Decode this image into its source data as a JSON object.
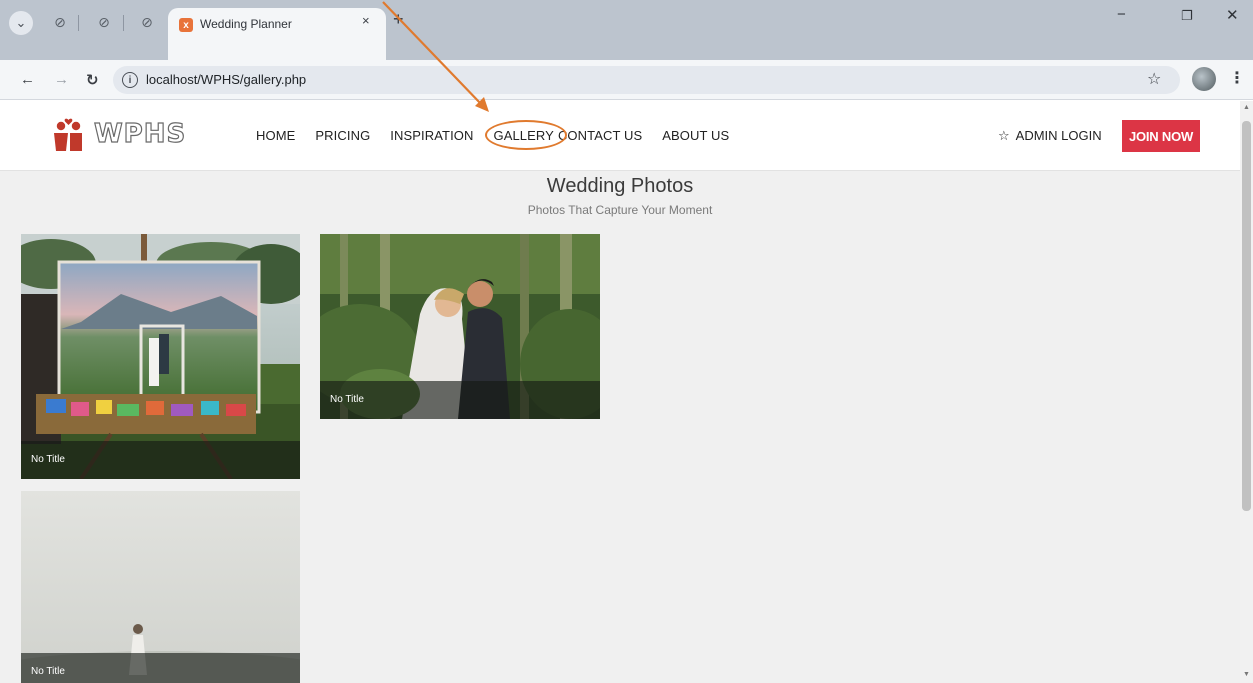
{
  "browser": {
    "tab_title": "Wedding Planner",
    "tab_close": "×",
    "new_tab": "+",
    "url": "localhost/WPHS/gallery.php",
    "min": "−",
    "restore": "❐",
    "close": "✕"
  },
  "header": {
    "logo_text": "WPHS",
    "nav": [
      "HOME",
      "PRICING",
      "INSPIRATION",
      "GALLERY",
      "CONTACT US",
      "ABOUT US"
    ],
    "active_nav": "GALLERY",
    "admin_login": "ADMIN LOGIN",
    "join_now": "JOIN NOW"
  },
  "page": {
    "title": "Wedding Photos",
    "subtitle": "Photos That Capture Your Moment"
  },
  "gallery": [
    {
      "caption": "No Title"
    },
    {
      "caption": "No Title"
    },
    {
      "caption": "No Title"
    }
  ],
  "colors": {
    "join_button": "#dc3545",
    "annotation": "#e07a2e",
    "logo_red": "#c0392b"
  }
}
